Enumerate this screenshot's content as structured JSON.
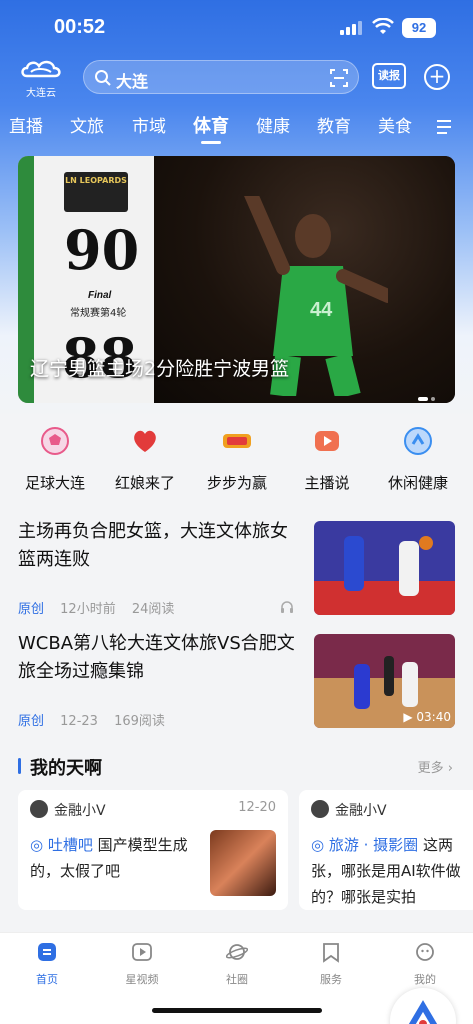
{
  "status": {
    "time": "00:52",
    "battery": "92"
  },
  "header": {
    "logo_text": "大连云",
    "search_text": "大连",
    "dubao_label": "读报"
  },
  "tabs": [
    {
      "label": "直播"
    },
    {
      "label": "文旅"
    },
    {
      "label": "市域"
    },
    {
      "label": "体育",
      "active": true
    },
    {
      "label": "健康"
    },
    {
      "label": "教育"
    },
    {
      "label": "美食"
    }
  ],
  "banner": {
    "caption": "辽宁男篮主场2分险胜宁波男篮",
    "team_logo": "LN LEOPARDS",
    "score_home": "90",
    "score_away": "88",
    "final_label": "Final",
    "round_label": "常规赛第4轮"
  },
  "shortcuts": [
    {
      "label": "足球大连",
      "icon": "soccer-ball-icon",
      "color": "#e85a8a"
    },
    {
      "label": "红娘来了",
      "icon": "matchmaker-icon",
      "color": "#e23b3b"
    },
    {
      "label": "步步为赢",
      "icon": "steps-icon",
      "color": "#f0a020"
    },
    {
      "label": "主播说",
      "icon": "broadcaster-icon",
      "color": "#f07050"
    },
    {
      "label": "休闲健康",
      "icon": "fitness-icon",
      "color": "#3a8ef0"
    }
  ],
  "news": [
    {
      "title": "主场再负合肥女篮，大连文体旅女篮两连败",
      "tag": "原创",
      "time": "12小时前",
      "reads": "24阅读"
    },
    {
      "title": "WCBA第八轮大连文体旅VS合肥文旅全场过瘾集锦",
      "tag": "原创",
      "time": "12-23",
      "reads": "169阅读",
      "duration": "03:40"
    }
  ],
  "section": {
    "title": "我的天啊",
    "more": "更多"
  },
  "cards": [
    {
      "user": "金融小V",
      "date": "12-20",
      "topic": "吐槽吧",
      "text_line1": " 国产模型生成",
      "text_line2": "的，太假了吧"
    },
    {
      "user": "金融小V",
      "topic": "旅游 · 摄影圈",
      "text_line1": " 这两",
      "text_line2": "张，哪张是用AI软件做",
      "text_line3": "的？哪张是实拍"
    }
  ],
  "bottomnav": [
    {
      "label": "首页",
      "icon": "home-icon",
      "active": true
    },
    {
      "label": "星视频",
      "icon": "video-icon"
    },
    {
      "label": "社圈",
      "icon": "planet-icon"
    },
    {
      "label": "服务",
      "icon": "bookmark-icon"
    },
    {
      "label": "我的",
      "icon": "profile-icon"
    }
  ]
}
